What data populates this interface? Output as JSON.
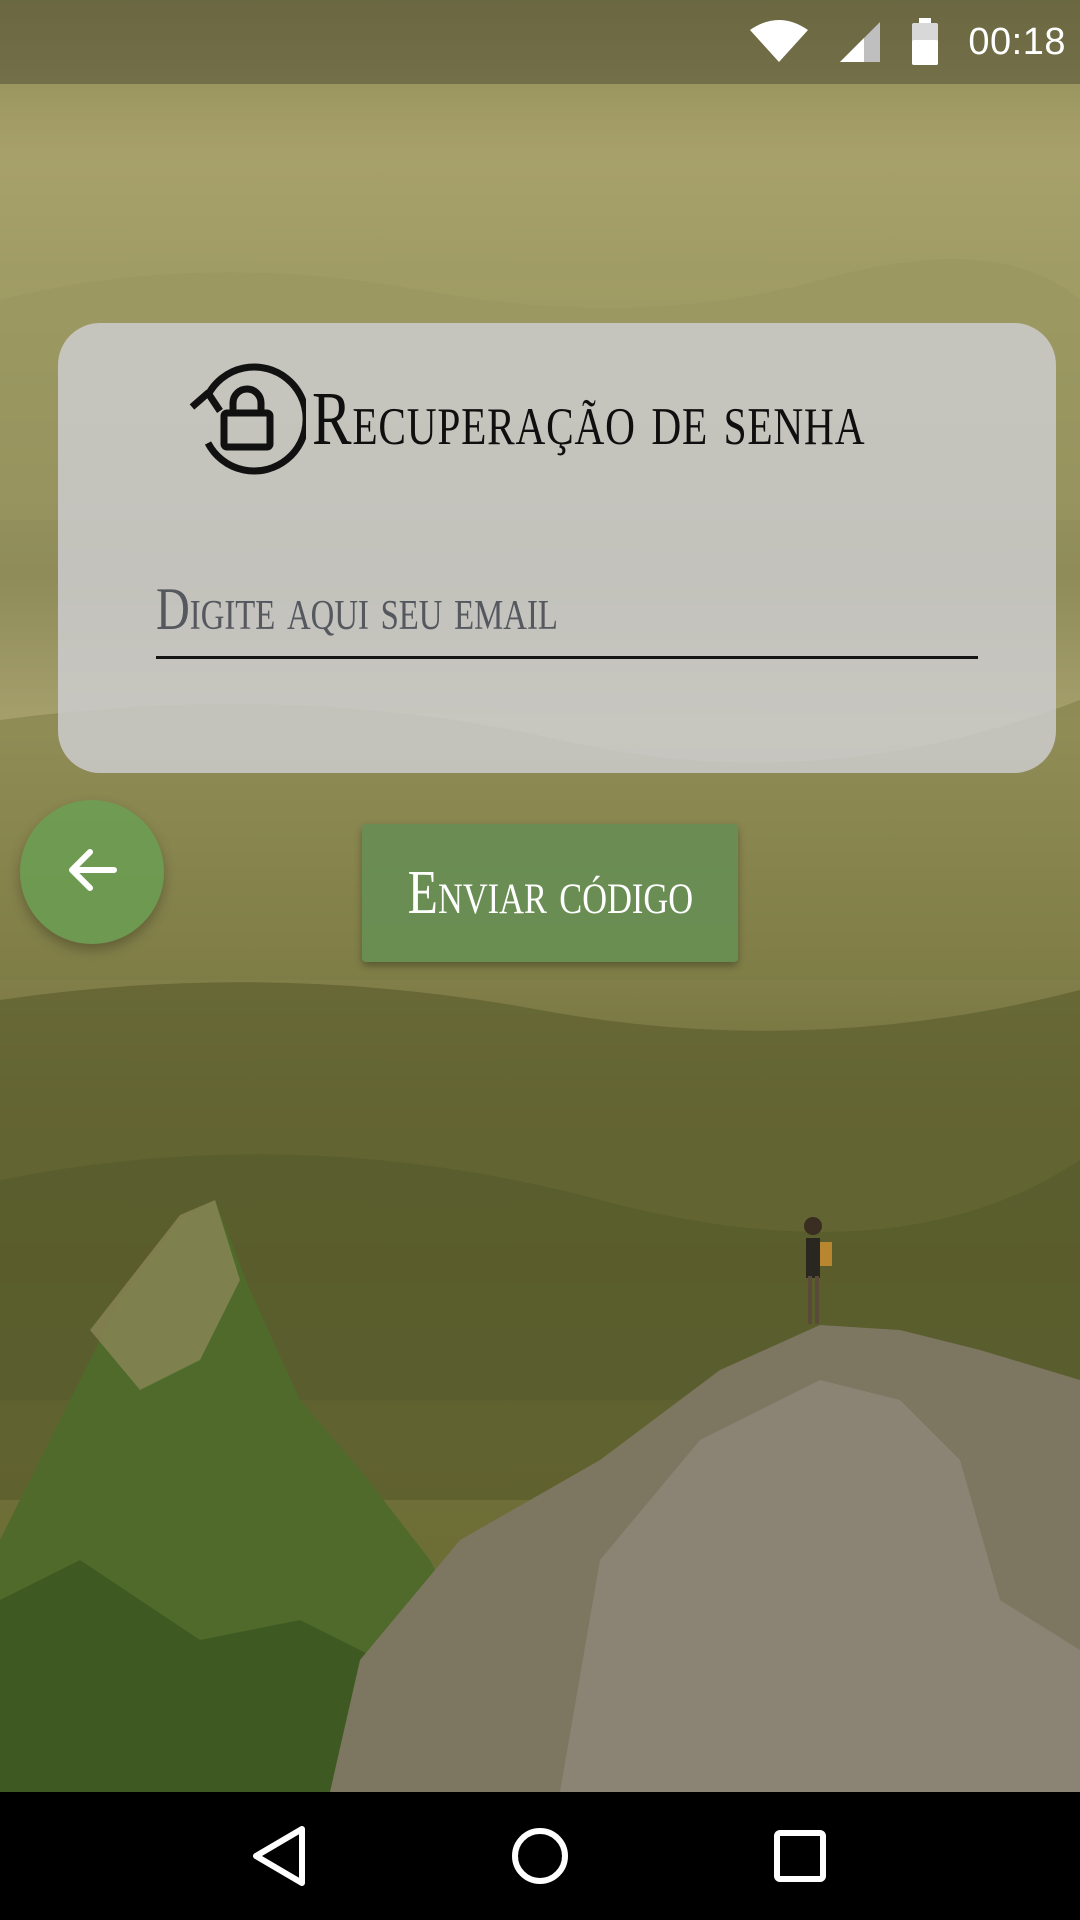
{
  "status_bar": {
    "time": "00:18",
    "icons": [
      "wifi-icon",
      "cell-signal-icon",
      "battery-icon"
    ]
  },
  "card": {
    "icon": "lock-reset-icon",
    "title": "Recuperação de senha",
    "email_field": {
      "placeholder": "Digite aqui seu email",
      "value": ""
    }
  },
  "back_button": {
    "icon": "arrow-left-icon"
  },
  "send_button": {
    "label": "Enviar código"
  },
  "nav_bar": {
    "icons": [
      "back-triangle-icon",
      "home-circle-icon",
      "recents-square-icon"
    ]
  },
  "colors": {
    "accent_green": "#688e54",
    "fab_green": "#68a052",
    "card_bg": "#cecec f"
  }
}
